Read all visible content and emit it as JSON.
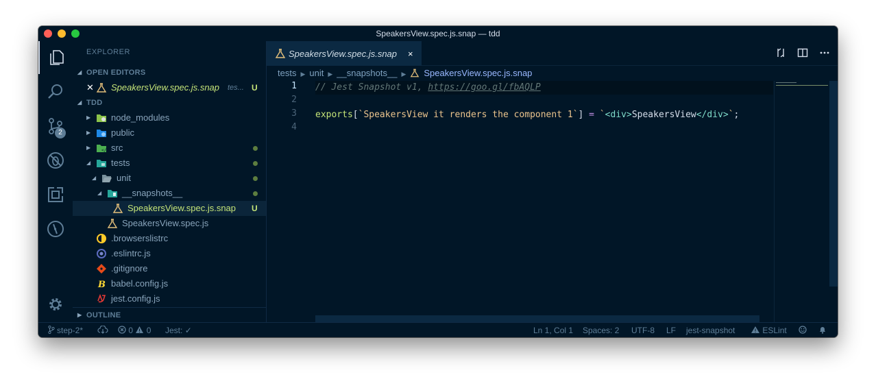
{
  "window": {
    "title": "SpeakersView.spec.js.snap — tdd"
  },
  "activity_bar": {
    "items": [
      {
        "name": "explorer",
        "icon": "files-icon"
      },
      {
        "name": "search",
        "icon": "search-icon"
      },
      {
        "name": "source-control",
        "icon": "source-control-icon",
        "badge": "2"
      },
      {
        "name": "debug",
        "icon": "debug-icon"
      },
      {
        "name": "extensions",
        "icon": "extensions-icon"
      },
      {
        "name": "git-history",
        "icon": "gauge-icon"
      }
    ],
    "settings_icon": "gear-icon"
  },
  "sidebar": {
    "title": "EXPLORER",
    "open_editors": {
      "label": "OPEN EDITORS",
      "items": [
        {
          "name": "SpeakersView.spec.js.snap",
          "path": "tes...",
          "status": "U"
        }
      ]
    },
    "folder": {
      "label": "TDD",
      "items": [
        {
          "name": "node_modules",
          "kind": "folder",
          "depth": 0
        },
        {
          "name": "public",
          "kind": "folder",
          "depth": 0
        },
        {
          "name": "src",
          "kind": "folder",
          "depth": 0
        },
        {
          "name": "tests",
          "kind": "folder",
          "depth": 0,
          "expanded": true
        },
        {
          "name": "unit",
          "kind": "folder",
          "depth": 1,
          "expanded": true
        },
        {
          "name": "__snapshots__",
          "kind": "folder",
          "depth": 2,
          "expanded": true
        },
        {
          "name": "SpeakersView.spec.js.snap",
          "kind": "file",
          "depth": 3,
          "status": "U",
          "selected": true
        },
        {
          "name": "SpeakersView.spec.js",
          "kind": "file",
          "depth": 2
        },
        {
          "name": ".browserslistrc",
          "kind": "file",
          "depth": 0
        },
        {
          "name": ".eslintrc.js",
          "kind": "file",
          "depth": 0
        },
        {
          "name": ".gitignore",
          "kind": "file",
          "depth": 0
        },
        {
          "name": "babel.config.js",
          "kind": "file",
          "depth": 0
        },
        {
          "name": "jest.config.js",
          "kind": "file",
          "depth": 0
        }
      ]
    },
    "outline": {
      "label": "OUTLINE"
    }
  },
  "editor": {
    "tab": {
      "label": "SpeakersView.spec.js.snap",
      "close": "×"
    },
    "breadcrumb": [
      "tests",
      "unit",
      "__snapshots__",
      "SpeakersView.spec.js.snap"
    ],
    "lines": [
      {
        "num": "1",
        "comment": "// Jest Snapshot v1, ",
        "link": "https://goo.gl/fbAQLP"
      },
      {
        "num": "2"
      },
      {
        "num": "3",
        "ident": "exports",
        "open": "[",
        "key": "`SpeakersView it renders the component 1`",
        "close": "]",
        "op": " = ",
        "tick1": "`",
        "tag1": "<div>",
        "text": "SpeakersView",
        "tag2": "</div>",
        "tick2": "`",
        "semi": ";"
      },
      {
        "num": "4"
      }
    ]
  },
  "status_bar": {
    "branch": "step-2*",
    "errors": "0",
    "warnings": "0",
    "jest": "Jest:",
    "position": "Ln 1, Col 1",
    "spaces": "Spaces: 2",
    "encoding": "UTF-8",
    "eol": "LF",
    "language": "jest-snapshot",
    "linter": "ESLint"
  },
  "colors": {
    "background": "#011627",
    "accent": "#c5e478",
    "string": "#ecc48d",
    "keyword": "#c792ea",
    "tag": "#7fdbca",
    "comment": "#637777"
  }
}
